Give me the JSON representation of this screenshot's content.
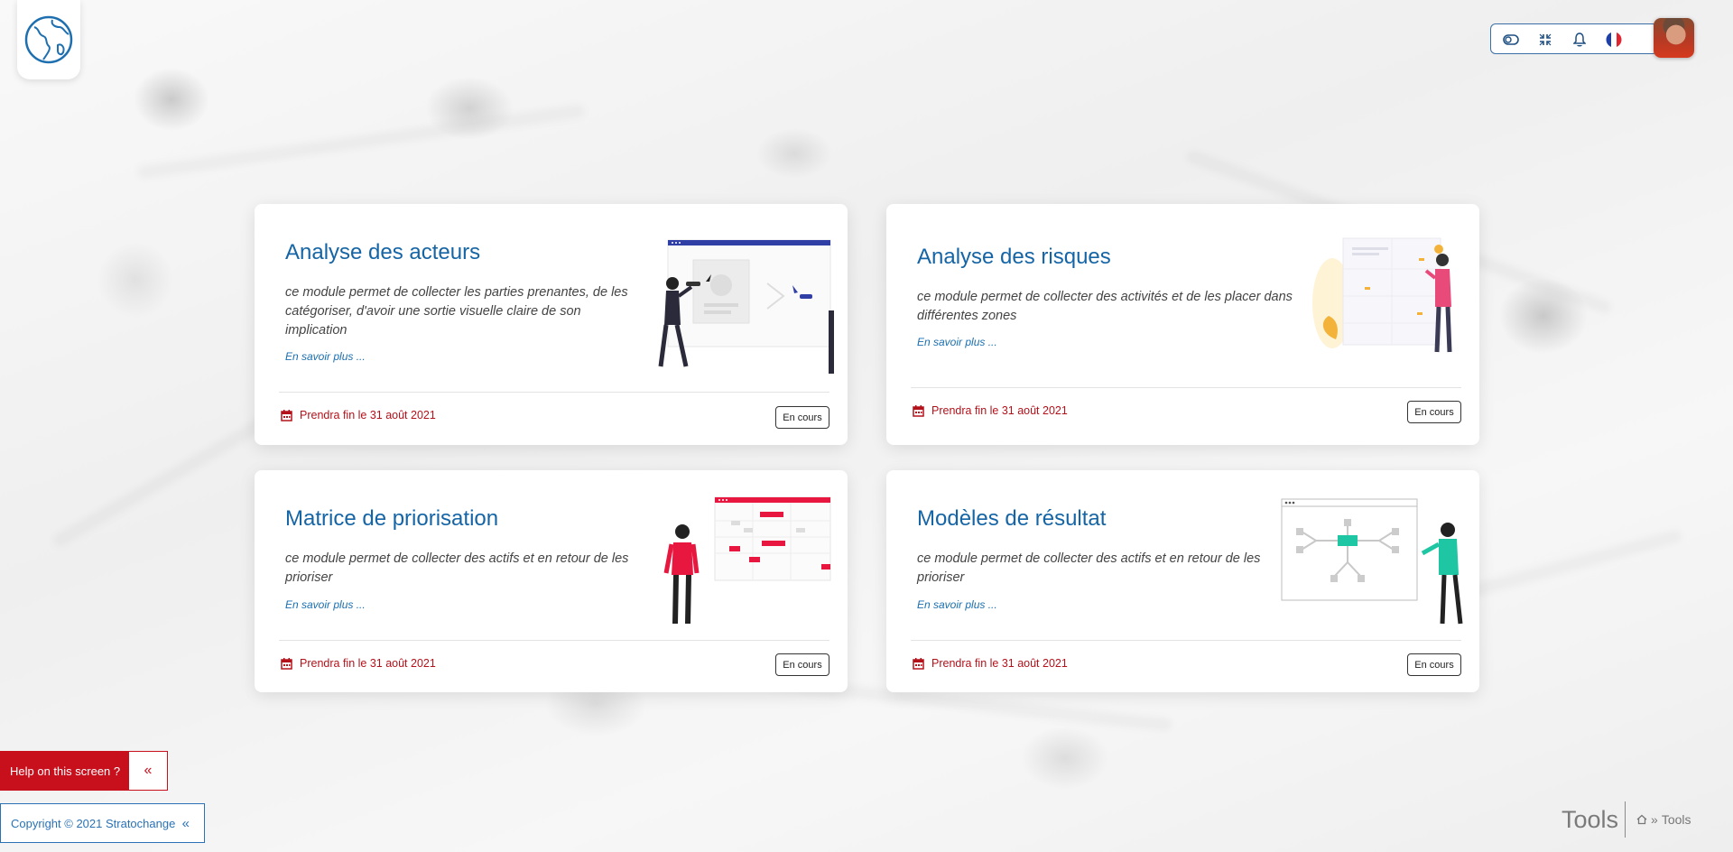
{
  "header": {
    "icons": [
      "toggle-icon",
      "compress-icon",
      "bell-icon",
      "french-flag-icon"
    ],
    "avatar_alt": "user-avatar"
  },
  "cards": [
    {
      "title": "Analyse des acteurs",
      "description": "ce module permet de collecter les parties prenantes, de les catégoriser, d'avoir une sortie visuelle claire de son implication",
      "more": "En savoir plus ...",
      "deadline": "Prendra fin le 31 août 2021",
      "status": "En cours"
    },
    {
      "title": "Analyse des risques",
      "description": "ce module permet de collecter des activités et de les placer dans différentes zones",
      "more": "En savoir plus ...",
      "deadline": "Prendra fin le 31 août 2021",
      "status": "En cours"
    },
    {
      "title": "Matrice de priorisation",
      "description": "ce module permet de collecter des actifs et en retour de les prioriser",
      "more": "En savoir plus ...",
      "deadline": "Prendra fin le 31 août 2021",
      "status": "En cours"
    },
    {
      "title": "Modèles de résultat",
      "description": "ce module permet de collecter des actifs et en retour de les prioriser",
      "more": "En savoir plus ...",
      "deadline": "Prendra fin le 31 août 2021",
      "status": "En cours"
    }
  ],
  "help": {
    "label": "Help on this screen ?",
    "toggle": "«"
  },
  "footer": {
    "copyright": "Copyright © 2021 Stratochange",
    "toggle": "«"
  },
  "breadcrumb": {
    "title": "Tools",
    "separator": "»",
    "current": "Tools"
  },
  "colors": {
    "accent": "#1565a6",
    "danger": "#c8101d",
    "deadline": "#b3121b"
  }
}
